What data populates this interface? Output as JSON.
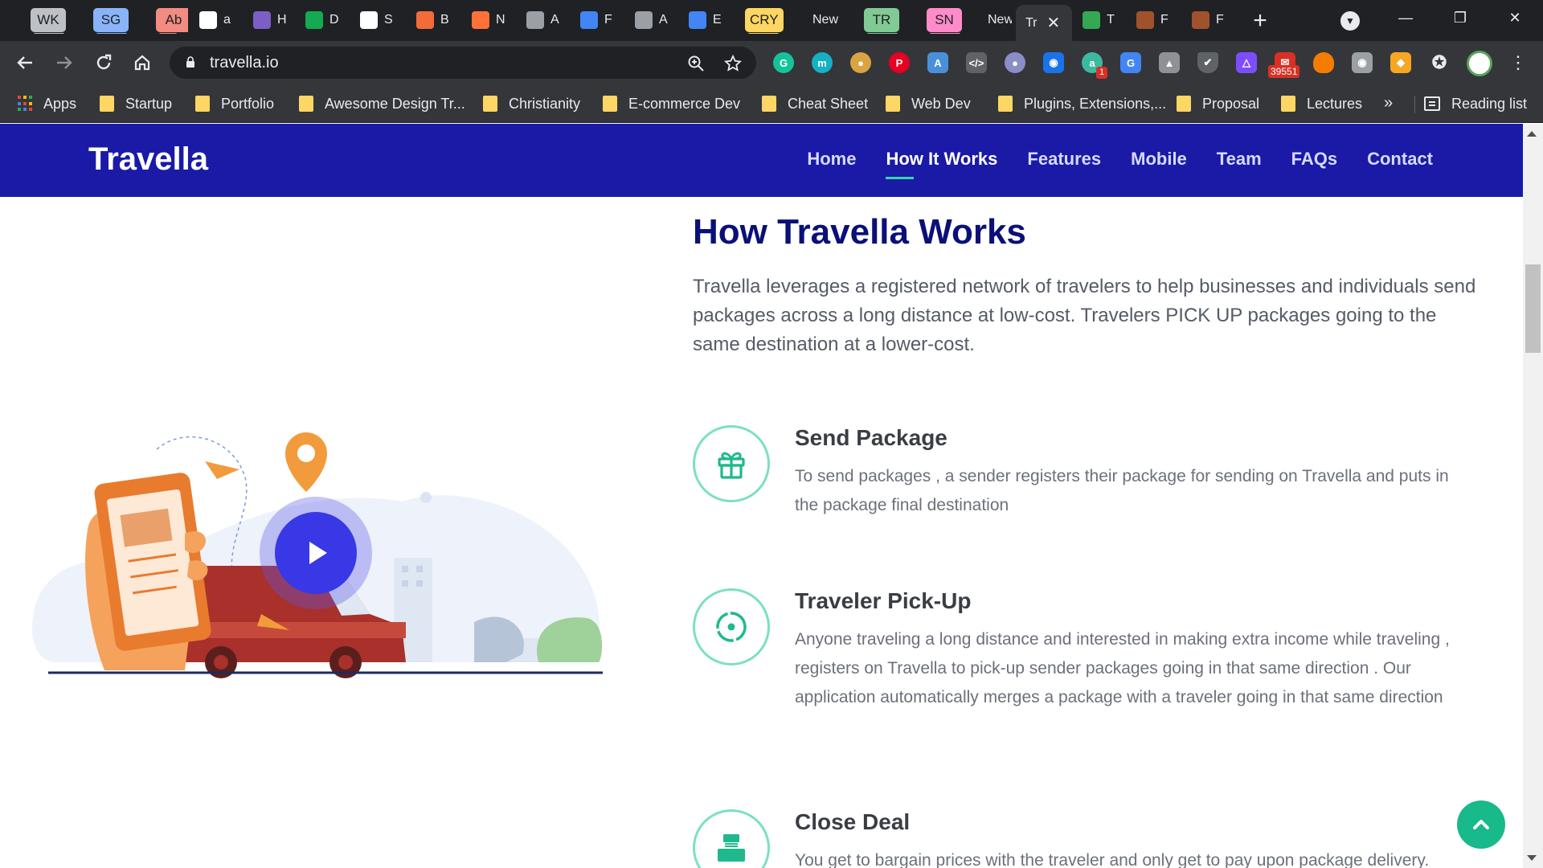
{
  "browser": {
    "tabs": [
      {
        "label": "WK",
        "kind": "group",
        "color": "#bdc1c6"
      },
      {
        "label": "SG",
        "kind": "group",
        "color": "#8ab4f8"
      },
      {
        "label": "Ab",
        "kind": "group",
        "color": "#f28b82"
      },
      {
        "label": "a",
        "kind": "tab",
        "icon": "document-icon",
        "color": "#ffffff"
      },
      {
        "label": "H",
        "kind": "tab",
        "icon": "hashnode-icon",
        "color": "#7b5fc7"
      },
      {
        "label": "D",
        "kind": "tab",
        "icon": "mongodb-leaf-icon",
        "color": "#13aa52"
      },
      {
        "label": "S",
        "kind": "tab",
        "icon": "github-icon",
        "color": "#ffffff"
      },
      {
        "label": "B",
        "kind": "tab",
        "icon": "bold-b-icon",
        "color": "#f26b3a"
      },
      {
        "label": "N",
        "kind": "tab",
        "icon": "firefox-icon",
        "color": "#ff7139"
      },
      {
        "label": "A",
        "kind": "tab",
        "icon": "globe-icon",
        "color": "#9aa0a6"
      },
      {
        "label": "F",
        "kind": "tab",
        "icon": "flag-icon",
        "color": "#4285f4"
      },
      {
        "label": "A",
        "kind": "tab",
        "icon": "globe-icon",
        "color": "#9aa0a6"
      },
      {
        "label": "E",
        "kind": "tab",
        "icon": "cloud-icon",
        "color": "#4285f4"
      },
      {
        "label": "CRY",
        "kind": "group",
        "color": "#fdd663"
      },
      {
        "label": "New",
        "kind": "plain"
      },
      {
        "label": "TR",
        "kind": "group",
        "color": "#81c995"
      },
      {
        "label": "SN",
        "kind": "group",
        "color": "#ff8bcb"
      },
      {
        "label": "New",
        "kind": "plain"
      },
      {
        "label": "Tr",
        "kind": "active"
      },
      {
        "label": "T",
        "kind": "tab",
        "icon": "play-store-icon",
        "color": "#34a853"
      },
      {
        "label": "F",
        "kind": "tab",
        "icon": "profile-picture-icon",
        "color": "#a0522d"
      },
      {
        "label": "F",
        "kind": "tab",
        "icon": "profile-picture-icon",
        "color": "#a0522d"
      }
    ],
    "url": "travella.io",
    "bookmarks": [
      {
        "label": "Apps",
        "kind": "apps"
      },
      {
        "label": "Startup"
      },
      {
        "label": "Portfolio"
      },
      {
        "label": "Awesome Design Tr..."
      },
      {
        "label": "Christianity"
      },
      {
        "label": "E-commerce Dev"
      },
      {
        "label": "Cheat Sheet"
      },
      {
        "label": "Web Dev"
      },
      {
        "label": "Plugins, Extensions,..."
      },
      {
        "label": "Proposal"
      },
      {
        "label": "Lectures"
      }
    ],
    "more_bookmarks": "»",
    "reading_list": "Reading list",
    "extension_badges": {
      "gmail_count": "39551",
      "notif_count": "1"
    }
  },
  "site": {
    "logo": "Travella",
    "nav": [
      "Home",
      "How It Works",
      "Features",
      "Mobile",
      "Team",
      "FAQs",
      "Contact"
    ],
    "active_nav": "How It Works",
    "accent": "#37d6a8",
    "brand": "#1a1aa7"
  },
  "section": {
    "title": "How Travella Works",
    "lead": "Travella leverages a registered network of travelers to help businesses and individuals send packages across a long distance at low-cost. Travelers PICK UP packages going to the same destination at a lower-cost.",
    "steps": [
      {
        "icon": "gift-icon",
        "title": "Send Package",
        "text": "To send packages , a sender registers their package for sending on Travella and puts in the package final destination"
      },
      {
        "icon": "target-icon",
        "title": "Traveler Pick-Up",
        "text": "Anyone traveling a long distance and interested in making extra income while traveling , registers on Travella to pick-up sender packages going in that same direction . Our application automatically merges a package with a traveler going in that same direction"
      },
      {
        "icon": "cash-register-icon",
        "title": "Close Deal",
        "text": "You get to bargain prices with the traveler and only get to pay upon package delivery."
      }
    ]
  }
}
